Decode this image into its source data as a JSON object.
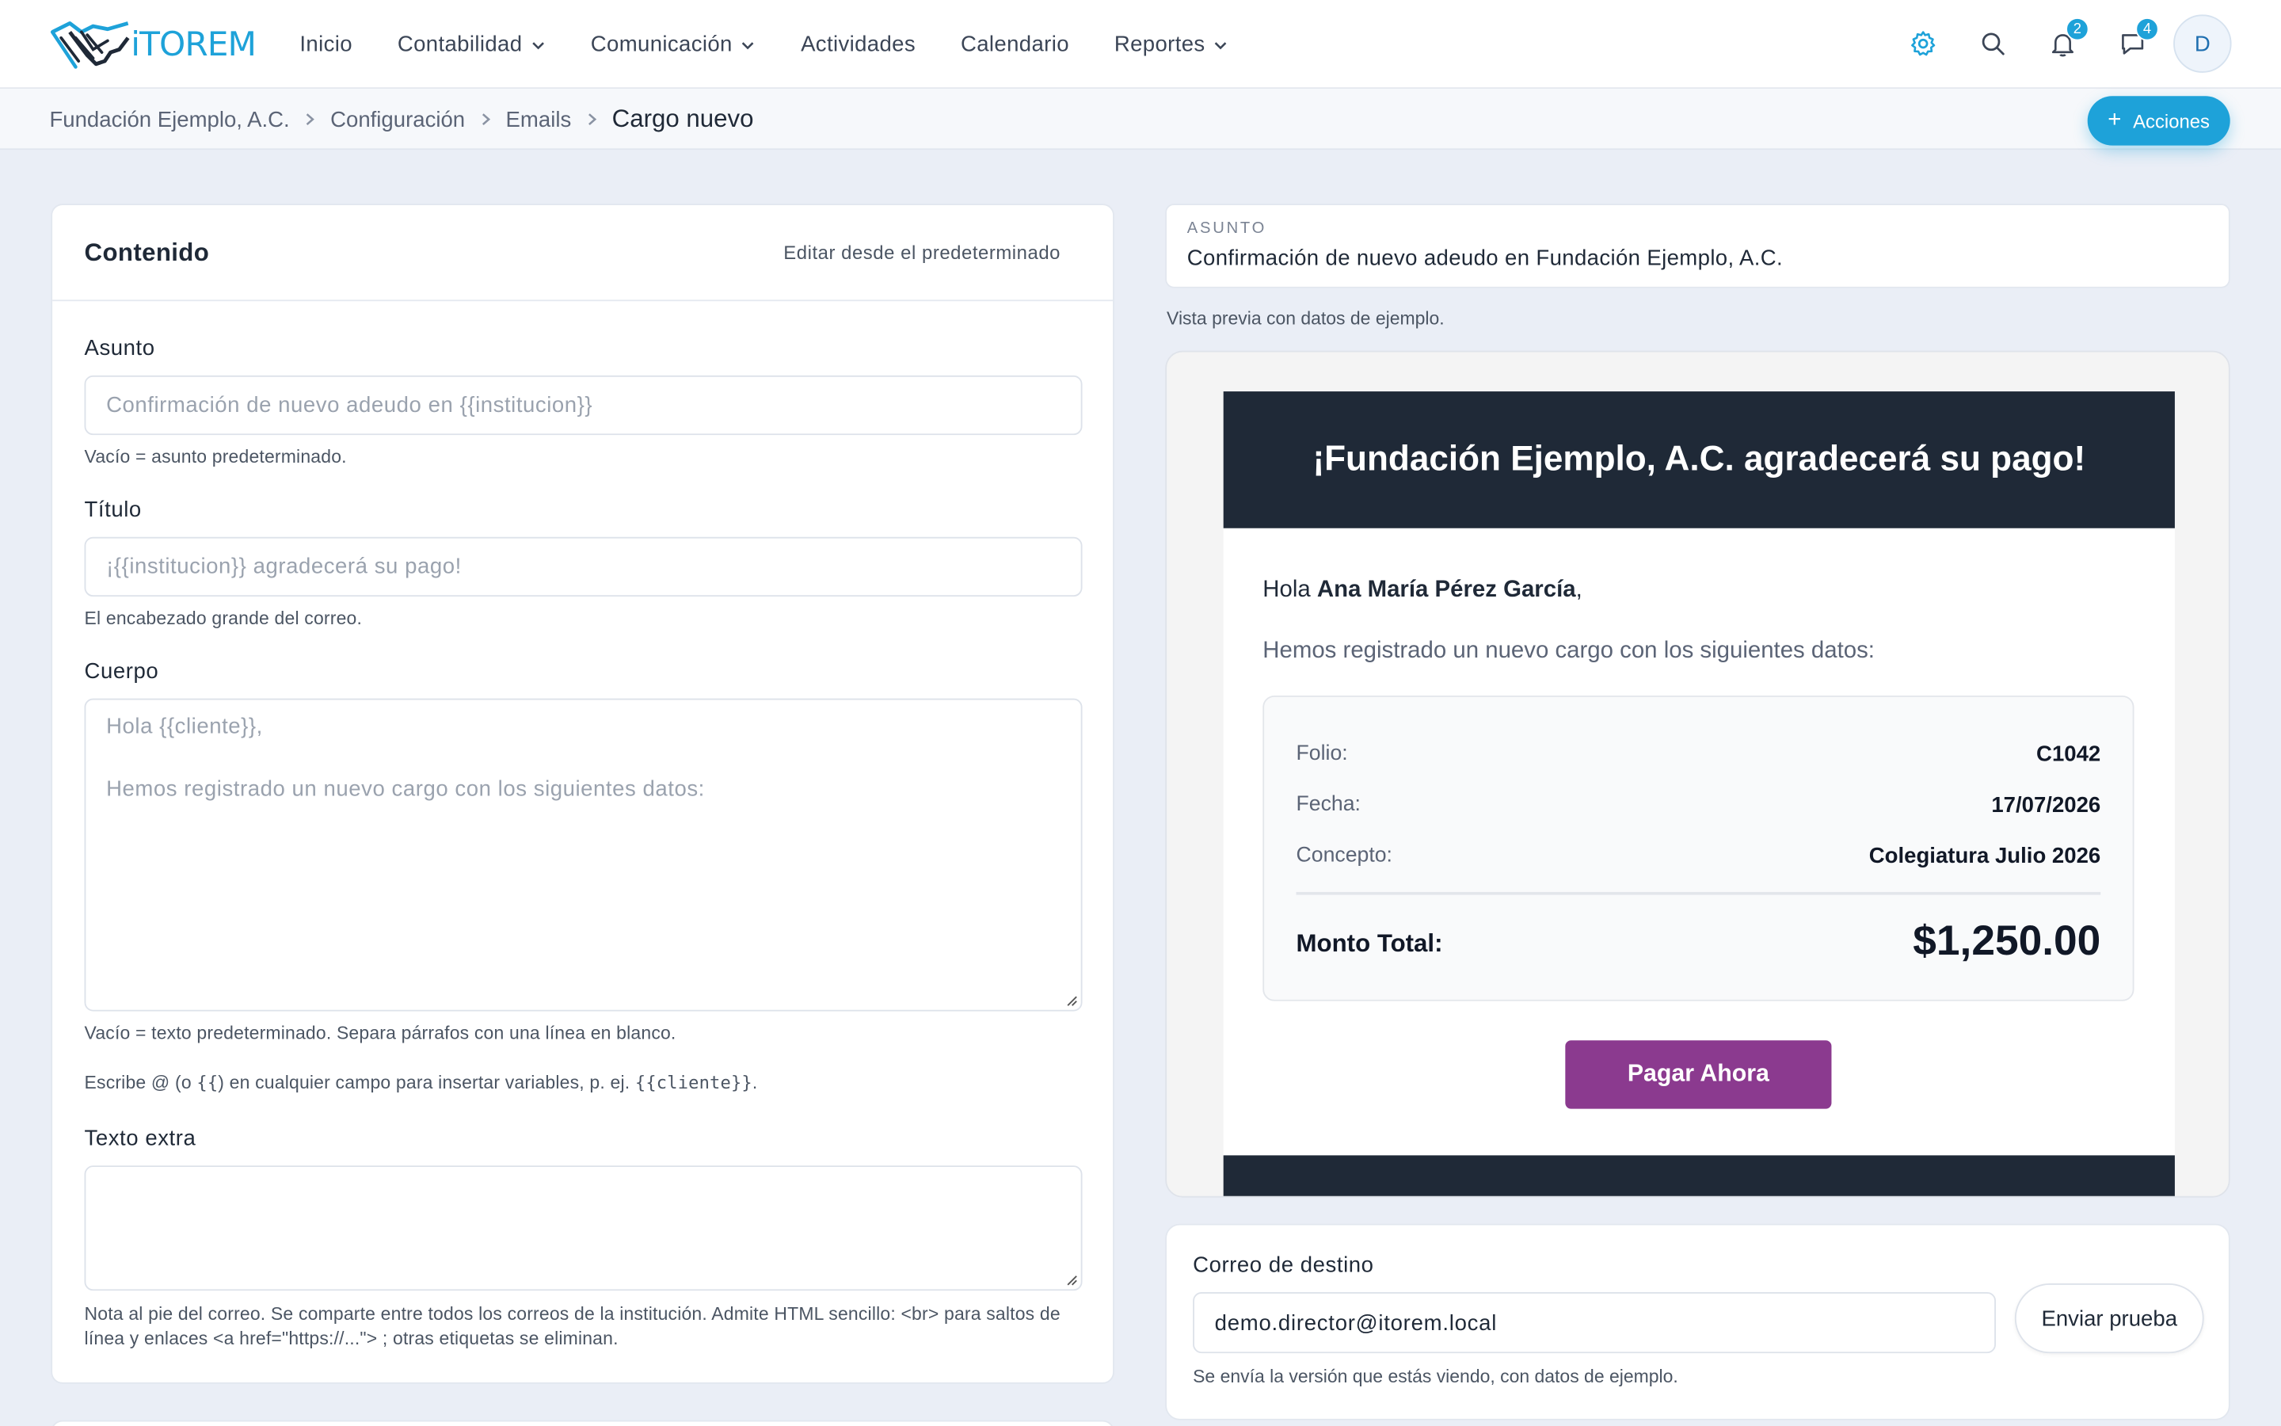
{
  "brand": {
    "name": "iTOREM",
    "accent": "#1ea2d9"
  },
  "nav": {
    "items": [
      {
        "label": "Inicio",
        "dropdown": false
      },
      {
        "label": "Contabilidad",
        "dropdown": true
      },
      {
        "label": "Comunicación",
        "dropdown": true
      },
      {
        "label": "Actividades",
        "dropdown": false
      },
      {
        "label": "Calendario",
        "dropdown": false
      },
      {
        "label": "Reportes",
        "dropdown": true
      }
    ],
    "notifications_count": "2",
    "messages_count": "4",
    "avatar_initial": "D"
  },
  "breadcrumb": {
    "items": [
      "Fundación Ejemplo, A.C.",
      "Configuración",
      "Emails"
    ],
    "current": "Cargo nuevo"
  },
  "actions_label": "Acciones",
  "content": {
    "title": "Contenido",
    "edit_default_label": "Editar desde el predeterminado",
    "subject": {
      "label": "Asunto",
      "placeholder": "Confirmación de nuevo adeudo en {{institucion}}",
      "hint": "Vacío = asunto predeterminado."
    },
    "heading": {
      "label": "Título",
      "placeholder": "¡{{institucion}} agradecerá su pago!",
      "hint": "El encabezado grande del correo."
    },
    "body": {
      "label": "Cuerpo",
      "placeholder_line1": "Hola {{cliente}},",
      "placeholder_line2": "Hemos registrado un nuevo cargo con los siguientes datos:",
      "hint": "Vacío = texto predeterminado. Separa párrafos con una línea en blanco."
    },
    "variables_hint": {
      "pre": "Escribe @ (o ",
      "code1": "{{",
      "mid": ") en cualquier campo para insertar variables, p. ej. ",
      "code2": "{{cliente}}",
      "post": "."
    },
    "extra": {
      "label": "Texto extra",
      "value": "",
      "hint_line1": "Nota al pie del correo. Se comparte entre todos los correos de la institución. Admite HTML sencillo: <br> para saltos de",
      "hint_line2": "línea y enlaces <a href=\"https://...\"> ; otras etiquetas se eliminan."
    }
  },
  "preview": {
    "subject_caption": "ASUNTO",
    "subject_value": "Confirmación de nuevo adeudo en Fundación Ejemplo, A.C.",
    "note": "Vista previa con datos de ejemplo.",
    "email": {
      "heading": "¡Fundación Ejemplo, A.C. agradecerá su pago!",
      "greeting_pre": "Hola ",
      "client_name": "Ana María Pérez García",
      "greeting_post": ",",
      "intro": "Hemos registrado un nuevo cargo con los siguientes datos:",
      "rows": [
        {
          "key": "Folio:",
          "value": "C1042"
        },
        {
          "key": "Fecha:",
          "value": "17/07/2026"
        },
        {
          "key": "Concepto:",
          "value": "Colegiatura Julio 2026"
        }
      ],
      "total_label": "Monto Total:",
      "total_value": "$1,250.00",
      "pay_label": "Pagar Ahora",
      "pay_color": "#8b3a8f",
      "header_color": "#1f2937"
    }
  },
  "destination": {
    "label": "Correo de destino",
    "value": "demo.director@itorem.local",
    "send_label": "Enviar prueba",
    "hint": "Se envía la versión que estás viendo, con datos de ejemplo."
  }
}
